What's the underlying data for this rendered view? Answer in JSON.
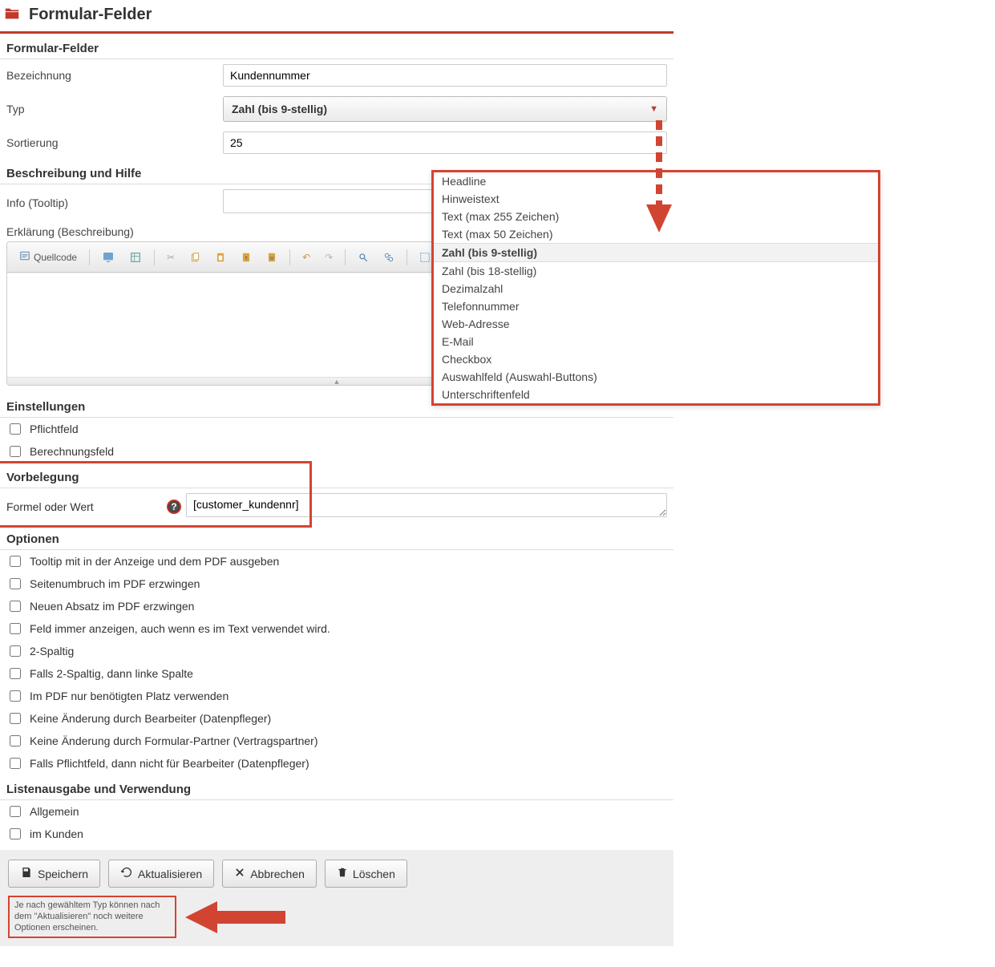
{
  "header": {
    "title": "Formular-Felder"
  },
  "sections": {
    "main_title": "Formular-Felder",
    "desc_title": "Beschreibung und Hilfe",
    "settings_title": "Einstellungen",
    "vorbelegung_title": "Vorbelegung",
    "optionen_title": "Optionen",
    "listen_title": "Listenausgabe und Verwendung"
  },
  "fields": {
    "bezeichnung": {
      "label": "Bezeichnung",
      "value": "Kundennummer"
    },
    "typ": {
      "label": "Typ",
      "value": "Zahl (bis 9-stellig)"
    },
    "sortierung": {
      "label": "Sortierung",
      "value": "25"
    },
    "info": {
      "label": "Info (Tooltip)",
      "value": ""
    },
    "erklaerung": {
      "label": "Erklärung (Beschreibung)"
    },
    "formel": {
      "label": "Formel oder Wert",
      "value": "[customer_kundennr]"
    }
  },
  "typ_options": [
    "Headline",
    "Hinweistext",
    "Text (max 255 Zeichen)",
    "Text (max 50 Zeichen)",
    "Zahl (bis 9-stellig)",
    "Zahl (bis 18-stellig)",
    "Dezimalzahl",
    "Telefonnummer",
    "Web-Adresse",
    "E-Mail",
    "Checkbox",
    "Auswahlfeld (Auswahl-Buttons)",
    "Unterschriftenfeld"
  ],
  "typ_selected_index": 4,
  "editor_toolbar": {
    "source": "Quellcode"
  },
  "settings_checks": [
    {
      "label": "Pflichtfeld",
      "checked": false
    },
    {
      "label": "Berechnungsfeld",
      "checked": false
    }
  ],
  "option_checks": [
    {
      "label": "Tooltip mit in der Anzeige und dem PDF ausgeben",
      "checked": false
    },
    {
      "label": "Seitenumbruch im PDF erzwingen",
      "checked": false
    },
    {
      "label": "Neuen Absatz im PDF erzwingen",
      "checked": false
    },
    {
      "label": "Feld immer anzeigen, auch wenn es im Text verwendet wird.",
      "checked": false
    },
    {
      "label": "2-Spaltig",
      "checked": false
    },
    {
      "label": "Falls 2-Spaltig, dann linke Spalte",
      "checked": false
    },
    {
      "label": "Im PDF nur benötigten Platz verwenden",
      "checked": false
    },
    {
      "label": "Keine Änderung durch Bearbeiter (Datenpfleger)",
      "checked": false
    },
    {
      "label": "Keine Änderung durch Formular-Partner (Vertragspartner)",
      "checked": false
    },
    {
      "label": "Falls Pflichtfeld, dann nicht für Bearbeiter (Datenpfleger)",
      "checked": false
    }
  ],
  "listen_checks": [
    {
      "label": "Allgemein",
      "checked": false
    },
    {
      "label": "im Kunden",
      "checked": false
    }
  ],
  "actions": {
    "save": "Speichern",
    "refresh": "Aktualisieren",
    "cancel": "Abbrechen",
    "delete": "Löschen"
  },
  "hint": "Je nach gewähltem Typ können nach dem \"Aktualisieren\" noch weitere Optionen erscheinen."
}
